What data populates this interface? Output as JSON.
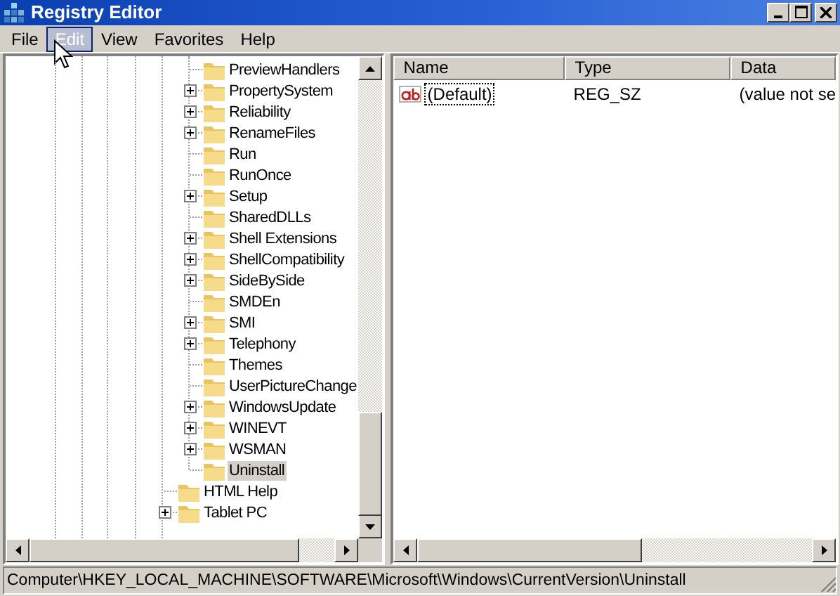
{
  "window": {
    "title": "Registry Editor"
  },
  "menu": [
    {
      "label": "File",
      "selected": false
    },
    {
      "label": "Edit",
      "selected": true
    },
    {
      "label": "View",
      "selected": false
    },
    {
      "label": "Favorites",
      "selected": false
    },
    {
      "label": "Help",
      "selected": false
    }
  ],
  "tree": {
    "items": [
      {
        "children": [
          {
            "label": "PreviewHandlers",
            "expandable": false,
            "selected": false
          },
          {
            "label": "PropertySystem",
            "expandable": true,
            "selected": false
          },
          {
            "label": "Reliability",
            "expandable": true,
            "selected": false
          },
          {
            "label": "RenameFiles",
            "expandable": true,
            "selected": false
          },
          {
            "label": "Run",
            "expandable": false,
            "selected": false
          },
          {
            "label": "RunOnce",
            "expandable": false,
            "selected": false
          },
          {
            "label": "Setup",
            "expandable": true,
            "selected": false
          },
          {
            "label": "SharedDLLs",
            "expandable": false,
            "selected": false
          },
          {
            "label": "Shell Extensions",
            "expandable": true,
            "selected": false
          },
          {
            "label": "ShellCompatibility",
            "expandable": true,
            "selected": false
          },
          {
            "label": "SideBySide",
            "expandable": true,
            "selected": false
          },
          {
            "label": "SMDEn",
            "expandable": false,
            "selected": false
          },
          {
            "label": "SMI",
            "expandable": true,
            "selected": false
          },
          {
            "label": "Telephony",
            "expandable": true,
            "selected": false
          },
          {
            "label": "Themes",
            "expandable": false,
            "selected": false
          },
          {
            "label": "UserPictureChange",
            "expandable": false,
            "selected": false
          },
          {
            "label": "WindowsUpdate",
            "expandable": true,
            "selected": false
          },
          {
            "label": "WINEVT",
            "expandable": true,
            "selected": false
          },
          {
            "label": "WSMAN",
            "expandable": true,
            "selected": false
          },
          {
            "label": "Uninstall",
            "expandable": false,
            "selected": true
          }
        ]
      },
      {
        "label": "HTML Help",
        "expandable": false,
        "selected": false
      },
      {
        "label": "Tablet PC",
        "expandable": true,
        "selected": false
      }
    ]
  },
  "values": {
    "columns": [
      "Name",
      "Type",
      "Data"
    ],
    "rows": [
      {
        "name": "(Default)",
        "type": "REG_SZ",
        "data": "(value not se",
        "selected": true
      }
    ]
  },
  "status_bar": "Computer\\HKEY_LOCAL_MACHINE\\SOFTWARE\\Microsoft\\Windows\\CurrentVersion\\Uninstall"
}
